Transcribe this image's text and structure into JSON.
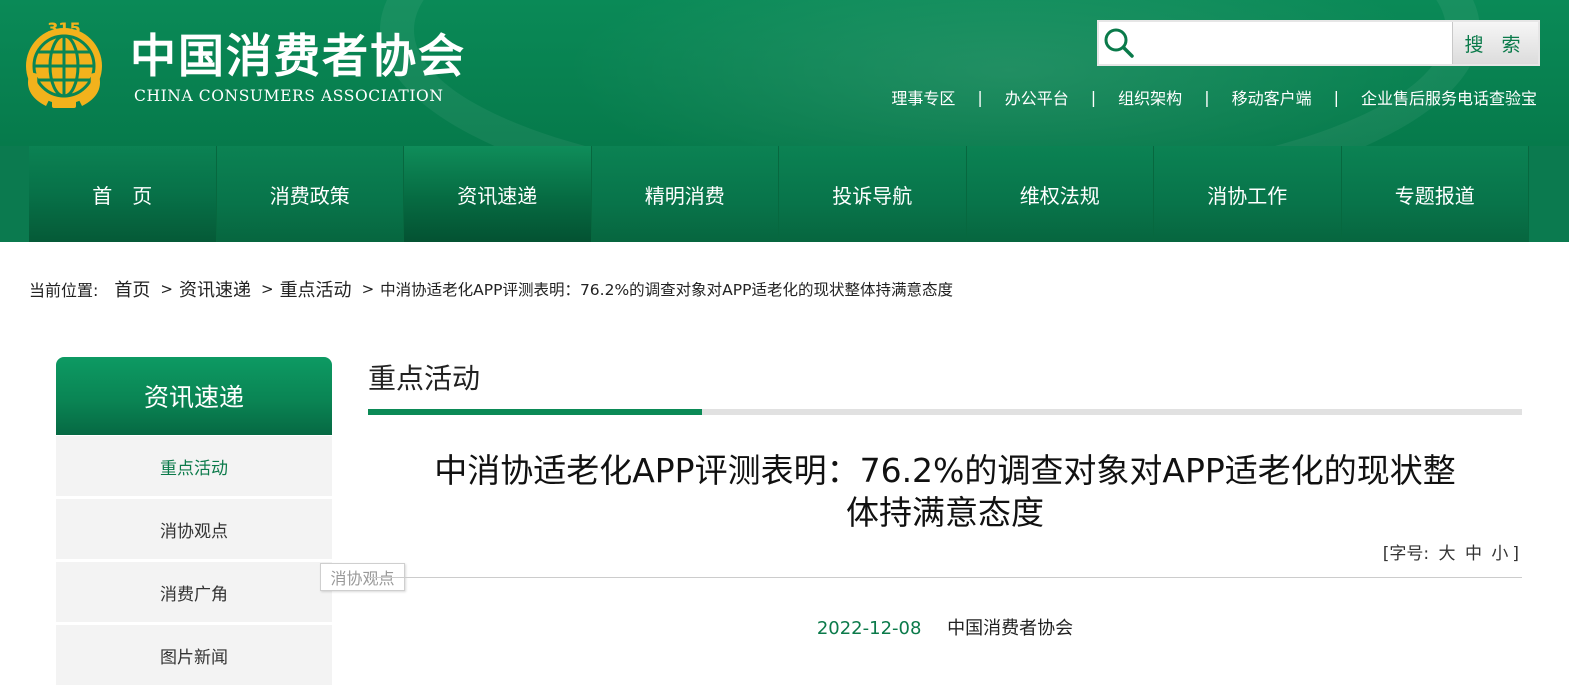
{
  "header": {
    "logo_text_cn": "中国消费者协会",
    "logo_text_en": "CHINA CONSUMERS ASSOCIATION",
    "emblem_text": "315",
    "search": {
      "placeholder": "",
      "value": "",
      "button_label": "搜 索"
    },
    "top_links": [
      "理事专区",
      "办公平台",
      "组织架构",
      "移动客户端",
      "企业售后服务电话查验宝"
    ],
    "separator": "|"
  },
  "nav": {
    "items": [
      "首　页",
      "消费政策",
      "资讯速递",
      "精明消费",
      "投诉导航",
      "维权法规",
      "消协工作",
      "专题报道"
    ],
    "active_index": 2
  },
  "breadcrumb": {
    "label": "当前位置:",
    "items": [
      "首页",
      "资讯速递",
      "重点活动"
    ],
    "current": "中消协适老化APP评测表明：76.2%的调查对象对APP适老化的现状整体持满意态度",
    "arrow": ">"
  },
  "sidebar": {
    "title": "资讯速递",
    "items": [
      "重点活动",
      "消协观点",
      "消费广角",
      "图片新闻"
    ],
    "active_index": 0,
    "tooltip": "消协观点"
  },
  "main": {
    "section_title": "重点活动",
    "article_title_line1": "中消协适老化APP评测表明：76.2%的调查对象对APP适老化的现状整",
    "article_title_line2": "体持满意态度",
    "font_size": {
      "prefix": "[字号:",
      "large": "大",
      "medium": "中",
      "small": "小",
      "suffix": "]"
    },
    "date": "2022-12-08",
    "source": "中国消费者协会"
  },
  "colors": {
    "brand_green": "#0b7a4a",
    "gold": "#f2b21c"
  }
}
